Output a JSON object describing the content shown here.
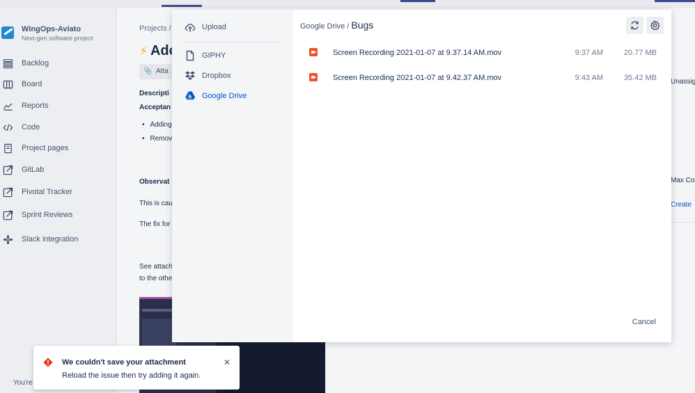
{
  "project": {
    "name": "WingOps-Aviato",
    "subtitle": "Next-gen software project"
  },
  "sidebar": {
    "items": [
      {
        "label": "Backlog"
      },
      {
        "label": "Board"
      },
      {
        "label": "Reports"
      },
      {
        "label": "Code"
      },
      {
        "label": "Project pages"
      },
      {
        "label": "GitLab"
      },
      {
        "label": "Pivotal Tracker"
      },
      {
        "label": "Sprint Reviews"
      },
      {
        "label": "Slack integration"
      }
    ]
  },
  "issue": {
    "breadcrumb": "Projects  /",
    "title": "Ado",
    "attach_label": "Atta",
    "description_label": "Descripti",
    "acceptance_label": "Acceptan",
    "bullets": [
      "Adding",
      "Remov"
    ],
    "observed_label": "Observat",
    "line1": "This is cau",
    "line2": "The fix for",
    "line3": "See attach",
    "line4": "to the othe",
    "right_unassigned": "Unassig",
    "right_max": "Max Co",
    "right_create": "Create"
  },
  "modal": {
    "sources": [
      {
        "label": "Upload",
        "icon": "cloud-upload-icon"
      },
      {
        "label": "GIPHY",
        "icon": "file-icon"
      },
      {
        "label": "Dropbox",
        "icon": "dropbox-icon"
      },
      {
        "label": "Google Drive",
        "icon": "google-drive-icon",
        "active": true
      }
    ],
    "path_root": "Google Drive",
    "path_sep": "/",
    "path_current": "Bugs",
    "files": [
      {
        "name": "Screen Recording 2021-01-07 at 9.37.14 AM.mov",
        "time": "9:37 AM",
        "size": "20.77 MB"
      },
      {
        "name": "Screen Recording 2021-01-07 at 9.42.37 AM.mov",
        "time": "9:43 AM",
        "size": "35.42 MB"
      }
    ],
    "cancel_label": "Cancel"
  },
  "toast": {
    "title": "We couldn't save your attachment",
    "body": "Reload the issue then try adding it again.",
    "close": "✕"
  },
  "footer_text": "You're",
  "colors": {
    "accent": "#0052cc",
    "error": "#de350b",
    "file_icon": "#f0522d"
  }
}
